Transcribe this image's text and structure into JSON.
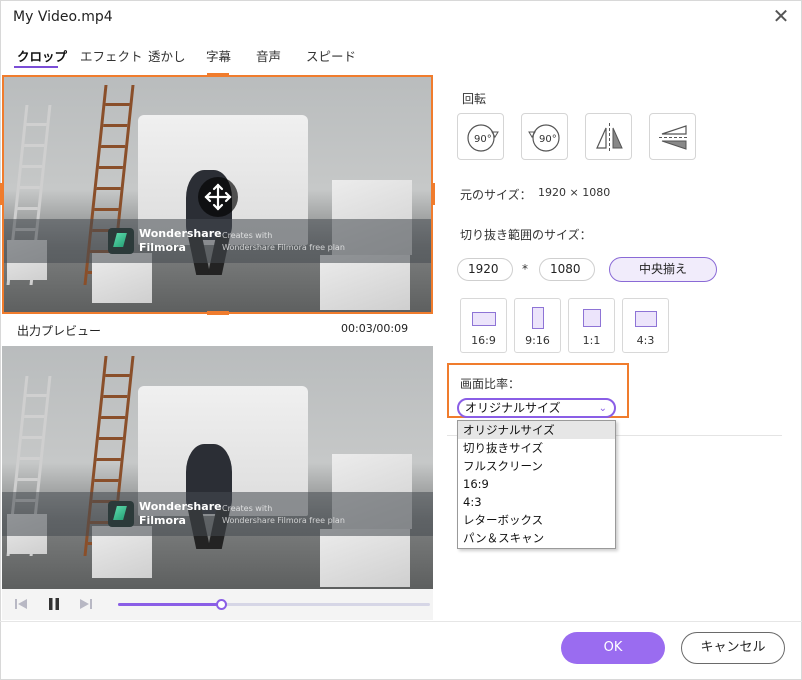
{
  "window": {
    "title": "My Video.mp4"
  },
  "tabs": [
    {
      "label": "クロップ"
    },
    {
      "label": "エフェクト"
    },
    {
      "label": "透かし"
    },
    {
      "label": "字幕"
    },
    {
      "label": "音声"
    },
    {
      "label": "スピード"
    }
  ],
  "watermark": {
    "brand_line1": "Wondershare",
    "brand_line2": "Filmora",
    "small1": "Creates with",
    "small2": "Wondershare Filmora free plan"
  },
  "preview": {
    "label": "出力プレビュー",
    "time": "00:03/00:09",
    "progress": 0.33
  },
  "rotation": {
    "label": "回転",
    "rot_left_text": "90°",
    "rot_right_text": "90°"
  },
  "original_size": {
    "label": "元のサイズ：",
    "value": "1920 × 1080"
  },
  "crop_size": {
    "label": "切り抜き範囲のサイズ：",
    "width": "1920",
    "separator": "*",
    "height": "1080",
    "center_button": "中央揃え"
  },
  "ratios": [
    {
      "label": "16:9"
    },
    {
      "label": "9:16"
    },
    {
      "label": "1:1"
    },
    {
      "label": "4:3"
    }
  ],
  "aspect": {
    "label": "画面比率：",
    "selected": "オリジナルサイズ",
    "options": [
      "オリジナルサイズ",
      "切り抜きサイズ",
      "フルスクリーン",
      "16:9",
      "4:3",
      "レターボックス",
      "パン＆スキャン"
    ]
  },
  "footer": {
    "ok": "OK",
    "cancel": "キャンセル"
  },
  "colors": {
    "accent": "#9a6cf0",
    "highlight": "#f07c2d"
  }
}
